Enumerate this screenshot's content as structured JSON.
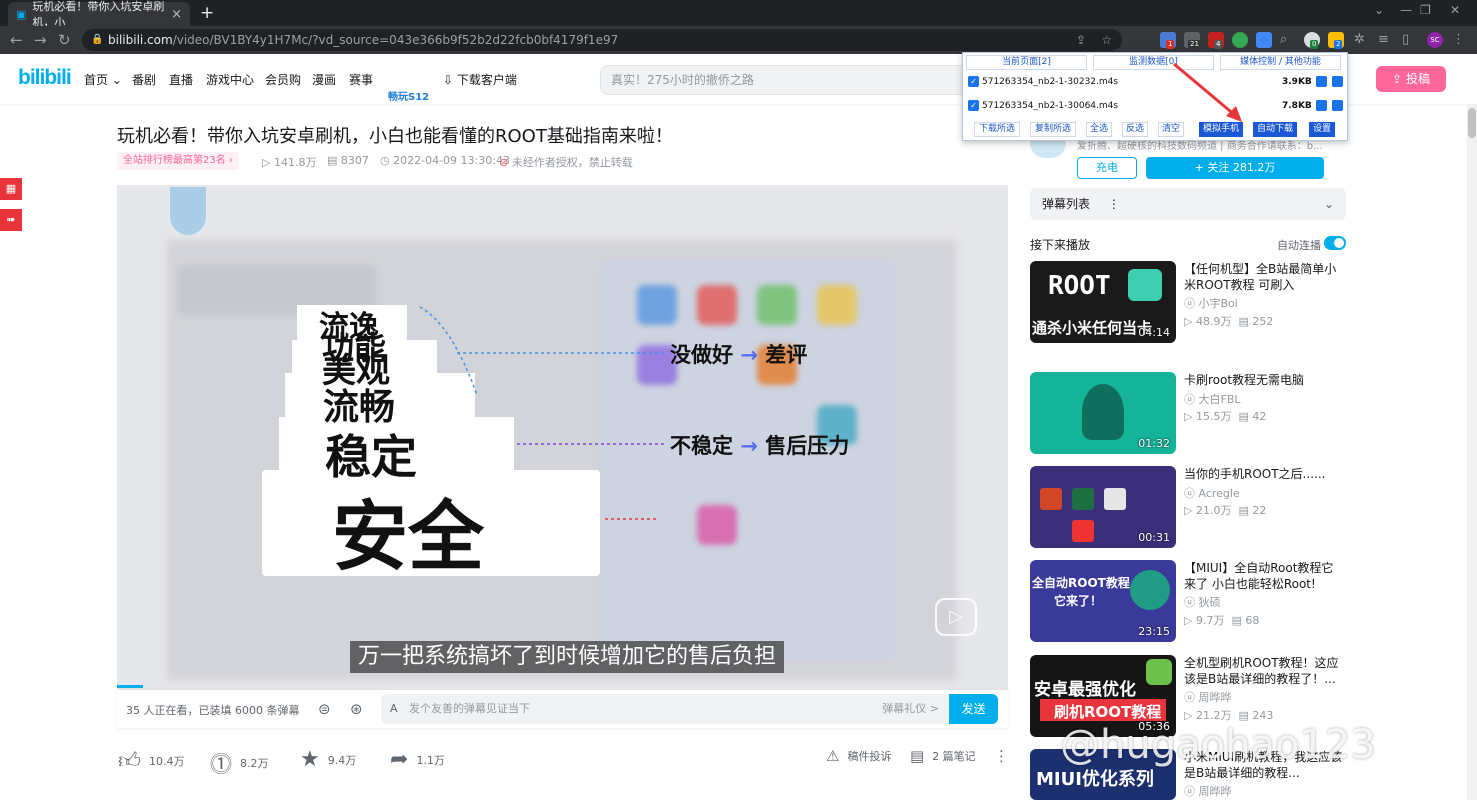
{
  "browser": {
    "tab_title": "玩机必看！带你入坑安卓刷机，小",
    "url_host": "bilibili.com",
    "url_path": "/video/BV1BY4y1H7Mc/?vd_source=043e366b9f52b2d22fcb0bf4179f1e97",
    "ext_badges": [
      "1",
      "21",
      "4",
      "0",
      "2"
    ],
    "profile": "SC"
  },
  "header": {
    "logo": "bilibili",
    "nav": [
      "首页",
      "番剧",
      "直播",
      "游戏中心",
      "会员购",
      "漫画",
      "赛事"
    ],
    "promo": "畅玩S12",
    "download_client": "下载客户端",
    "search_placeholder": "真实！275小时的撤侨之路",
    "upload": "投稿"
  },
  "video": {
    "title": "玩机必看！带你入坑安卓刷机，小白也能看懂的ROOT基础指南来啦！",
    "rank": "全站排行榜最高第23名",
    "views": "141.8万",
    "danmaku_count": "8307",
    "date": "2022-04-09 13:30:43",
    "copyright": "未经作者授权，禁止转载",
    "frame_words": [
      "流逸",
      "功能",
      "美观",
      "流畅",
      "稳定",
      "安全"
    ],
    "arrow_line_1": {
      "left": "没做好",
      "right": "差评"
    },
    "arrow_line_2": {
      "left": "不稳定",
      "right": "售后压力"
    },
    "subtitle": "万一把系统搞坏了到时候增加它的售后负担"
  },
  "danmaku": {
    "watching": "35 人正在看，已装填 6000 条弹幕",
    "input_placeholder": "发个友善的弹幕见证当下",
    "etiquette": "弹幕礼仪 >",
    "send": "发送"
  },
  "toolbar": {
    "like": "10.4万",
    "coin": "8.2万",
    "favorite": "9.4万",
    "share": "1.1万",
    "report": "稿件投诉",
    "notes": "2 篇笔记"
  },
  "sidebar": {
    "up_desc": "爱折腾、超硬核的科技数码频道 | 商务合作请联系：b...",
    "charge": "充电",
    "follow": "+ 关注 281.2万",
    "danmaku_list": "弹幕列表",
    "next_up": "接下来播放",
    "autoplay": "自动连播",
    "recommendations": [
      {
        "title": "【任何机型】全B站最简单小米ROOT教程 可刷入Magisk...",
        "up": "小宇Boi",
        "views": "48.9万",
        "danmaku": "252",
        "duration": "04:14",
        "thumb_text": "ROOT",
        "thumb_sub": "通杀小米任何当卡"
      },
      {
        "title": "卡刷root教程无需电脑",
        "up": "大白FBL",
        "views": "15.5万",
        "danmaku": "42",
        "duration": "01:32"
      },
      {
        "title": "当你的手机ROOT之后......",
        "up": "Acregle",
        "views": "21.0万",
        "danmaku": "22",
        "duration": "00:31"
      },
      {
        "title": "【MIUI】全自动Root教程它来了 小白也能轻松Root!",
        "up": "狄硕",
        "views": "9.7万",
        "danmaku": "68",
        "duration": "23:15",
        "thumb_text": "全自动ROOT教程",
        "thumb_sub": "它来了！"
      },
      {
        "title": "全机型刷机ROOT教程！这应该是B站最详细的教程了！...",
        "up": "周晔晔",
        "views": "21.2万",
        "danmaku": "243",
        "duration": "05:36",
        "thumb_text": "安卓最强优化",
        "thumb_sub": "刷机ROOT教程"
      },
      {
        "title": "小米MIUI刷机教程，我这应该是B站最详细的教程...",
        "up": "周晔晔",
        "views": "",
        "danmaku": "",
        "duration": "",
        "thumb_text": "MIUI优化系列"
      }
    ]
  },
  "popup": {
    "tabs": [
      "当前页面[2]",
      "监测数据[0]",
      "媒体控制 / 其他功能"
    ],
    "files": [
      {
        "name": "571263354_nb2-1-30232.m4s",
        "size": "3.9KB"
      },
      {
        "name": "571263354_nb2-1-30064.m4s",
        "size": "7.8KB"
      }
    ],
    "buttons": [
      "下载所选",
      "复制所选",
      "全选",
      "反选",
      "清空",
      "模拟手机",
      "自动下载",
      "设置"
    ]
  },
  "watermark": "@hugaohao123",
  "colors": {
    "accent": "#00aeec",
    "pink": "#ff6699",
    "arrow_red": "#e8343a",
    "popup_blue": "#1a58d6"
  }
}
